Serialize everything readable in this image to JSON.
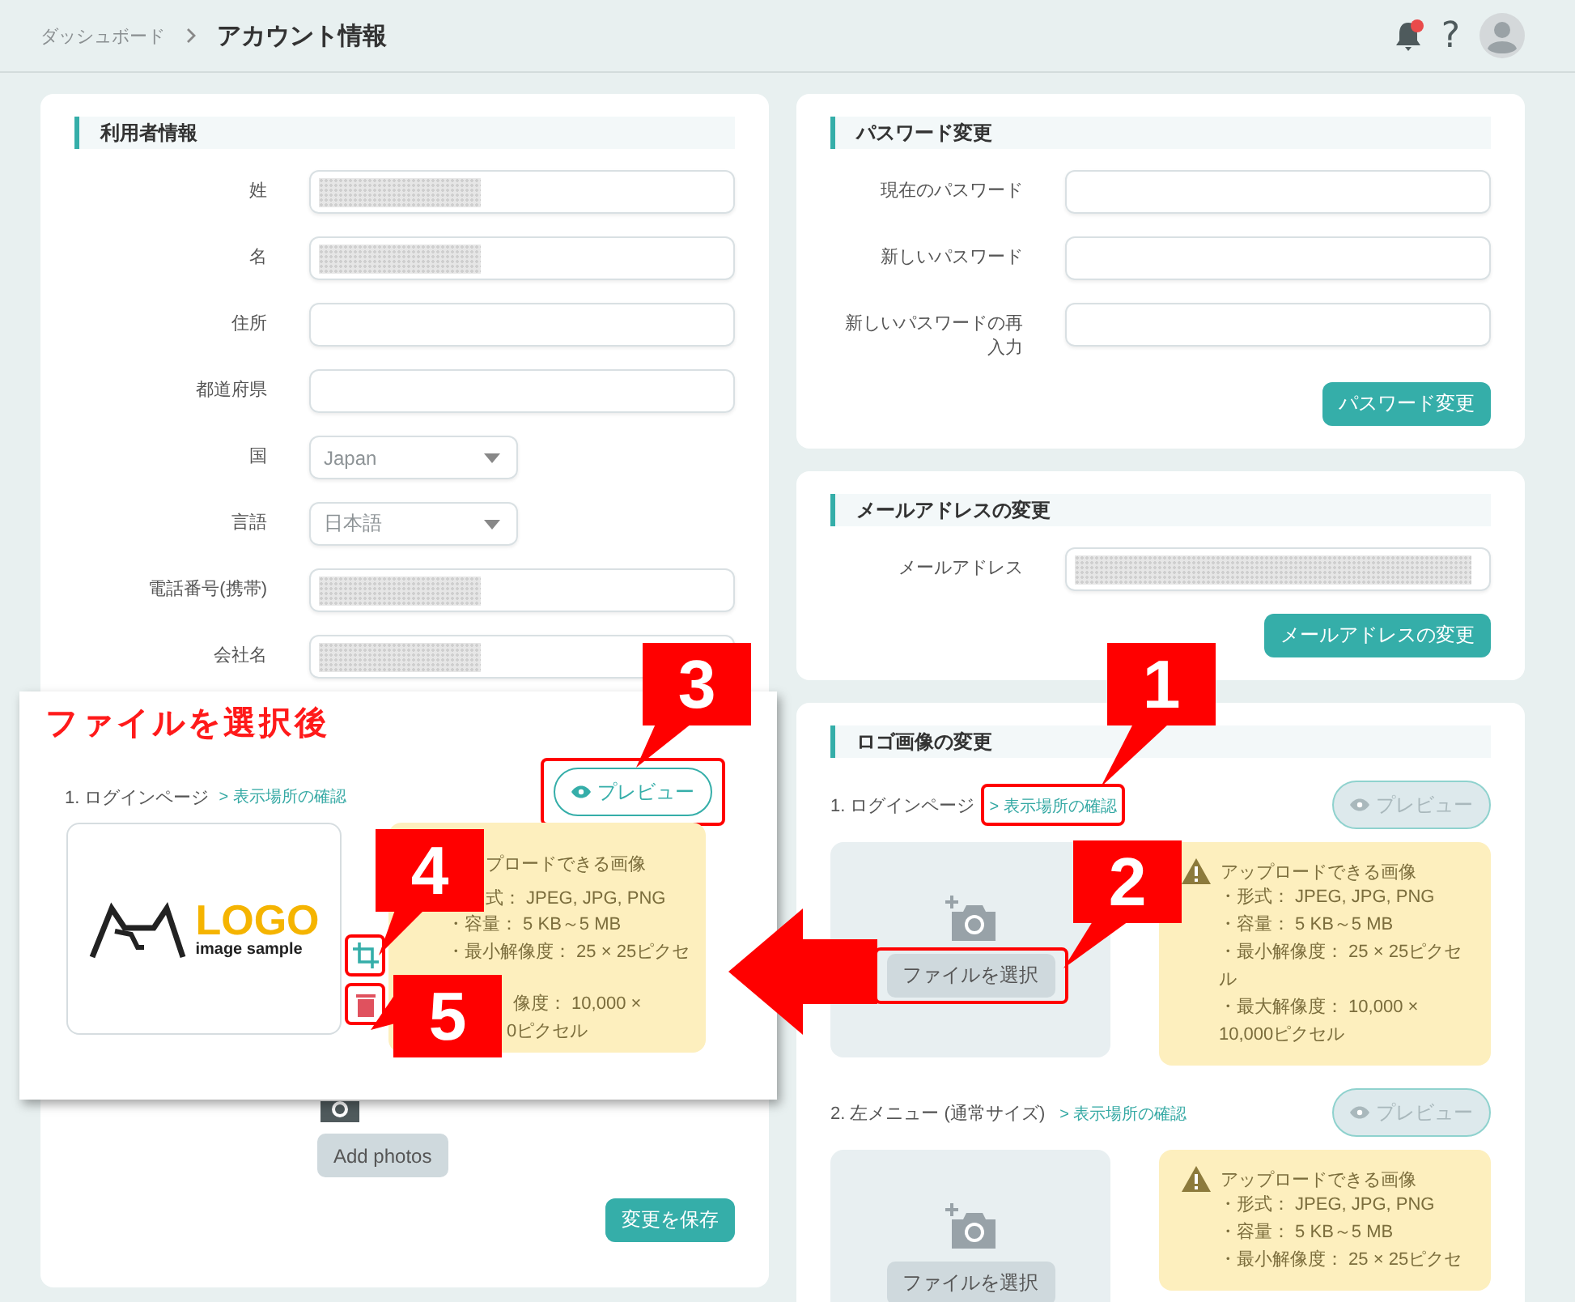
{
  "header": {
    "breadcrumb": [
      {
        "label": "ダッシュボード",
        "current": false
      },
      {
        "label": "アカウント情報",
        "current": true
      }
    ],
    "notifications_unread": true,
    "help": "?"
  },
  "user_info": {
    "title": "利用者情報",
    "fields": [
      {
        "label": "姓",
        "kind": "text",
        "redacted": true
      },
      {
        "label": "名",
        "kind": "text",
        "redacted": true
      },
      {
        "label": "住所",
        "kind": "text",
        "redacted": false
      },
      {
        "label": "都道府県",
        "kind": "text",
        "redacted": false
      },
      {
        "label": "国",
        "kind": "select",
        "value": "Japan"
      },
      {
        "label": "言語",
        "kind": "select",
        "value": "日本語"
      },
      {
        "label": "電話番号(携帯)",
        "kind": "text",
        "redacted": true
      },
      {
        "label": "会社名",
        "kind": "text",
        "redacted": true
      }
    ],
    "add_photos": "Add photos",
    "save": "変更を保存"
  },
  "password": {
    "title": "パスワード変更",
    "fields": [
      {
        "label": "現在のパスワード"
      },
      {
        "label": "新しいパスワード"
      },
      {
        "label": "新しいパスワードの再入力"
      }
    ],
    "button": "パスワード変更"
  },
  "email": {
    "title": "メールアドレスの変更",
    "fields": [
      {
        "label": "メールアドレス",
        "redacted": true
      }
    ],
    "button": "メールアドレスの変更"
  },
  "logo": {
    "title": "ロゴ画像の変更",
    "slots": [
      {
        "label": "1. ログインページ",
        "link": "> 表示場所の確認",
        "link_highlighted": true,
        "preview": "プレビュー",
        "preview_disabled": true,
        "choose": "ファイルを選択",
        "choose_highlighted": true,
        "info_title": "アップロードできる画像",
        "info": [
          "・形式： JPEG, JPG, PNG",
          "・容量： 5 KB～5 MB",
          "・最小解像度： 25 × 25ピクセル",
          "・最大解像度： 10,000 × 10,000ピクセル"
        ]
      },
      {
        "label": "2. 左メニュー (通常サイズ)",
        "link": "> 表示場所の確認",
        "link_highlighted": false,
        "preview": "プレビュー",
        "preview_disabled": true,
        "choose": "ファイルを選択",
        "choose_highlighted": false,
        "info_title": "アップロードできる画像",
        "info": [
          "・形式： JPEG, JPG, PNG",
          "・容量： 5 KB～5 MB",
          "・最小解像度： 25 × 25ピクセ"
        ]
      }
    ]
  },
  "inset": {
    "title": "ファイルを選択後",
    "label": "1. ログインページ",
    "link": "> 表示場所の確認",
    "preview": "プレビュー",
    "preview_disabled": false,
    "preview_highlighted": true,
    "logo_text": "LOGO",
    "logo_subtext": "image sample",
    "crop_highlighted": true,
    "delete_highlighted": true,
    "info": [
      "プロードできる画像",
      "式： JPEG, JPG, PNG",
      "・容量： 5 KB～5 MB",
      "・最小解像度： 25 × 25ピクセ",
      "像度： 10,000 ×",
      "0ピクセル"
    ]
  },
  "callouts": [
    {
      "number": "1"
    },
    {
      "number": "2"
    },
    {
      "number": "3"
    },
    {
      "number": "4"
    },
    {
      "number": "5"
    }
  ]
}
